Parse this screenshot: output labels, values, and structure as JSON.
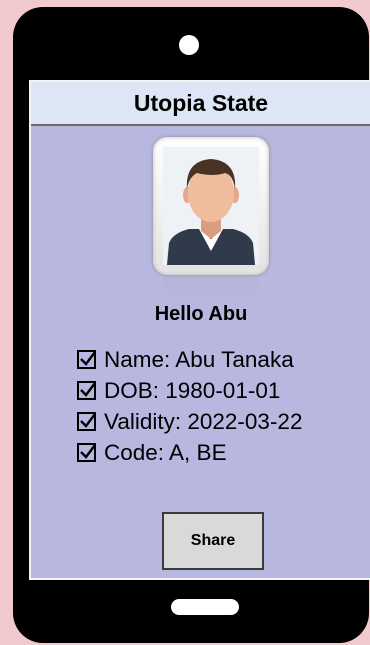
{
  "header": {
    "title": "Utopia State"
  },
  "profile": {
    "greeting": "Hello Abu",
    "photo_icon": "person-avatar-icon"
  },
  "details": [
    {
      "label": "Name: Abu Tanaka",
      "checked": true
    },
    {
      "label": "DOB: 1980-01-01",
      "checked": true
    },
    {
      "label": "Validity: 2022-03-22",
      "checked": true
    },
    {
      "label": "Code: A, BE",
      "checked": true
    }
  ],
  "actions": {
    "share_label": "Share"
  },
  "colors": {
    "screen": "#b8b7df",
    "header": "#dce6f5",
    "phone": "#000000",
    "page_background": "#f2c9cf",
    "button": "#d9d9d9"
  }
}
